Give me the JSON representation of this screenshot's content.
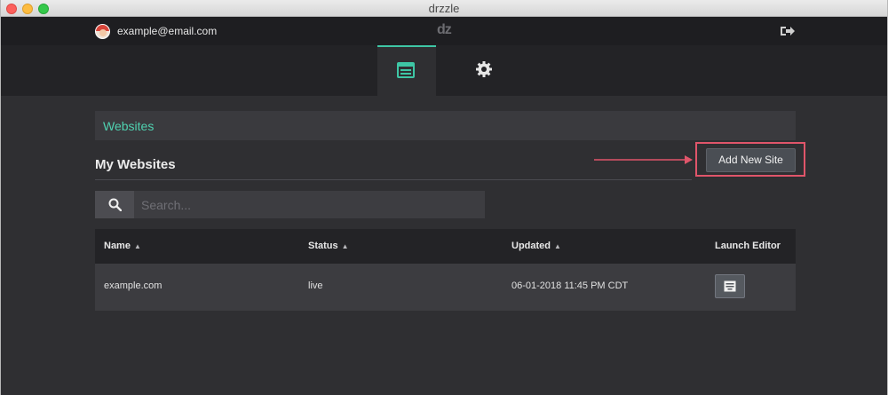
{
  "window": {
    "title": "drzzle"
  },
  "header": {
    "user_email": "example@email.com",
    "logo": "dz"
  },
  "nav": {
    "tabs": [
      {
        "name": "websites",
        "icon": "browser-window-icon",
        "active": true
      },
      {
        "name": "settings",
        "icon": "gear-icon",
        "active": false
      }
    ]
  },
  "section": {
    "title": "Websites"
  },
  "main": {
    "heading": "My Websites",
    "add_button_label": "Add New Site",
    "search_placeholder": "Search...",
    "table": {
      "columns": [
        "Name",
        "Status",
        "Updated",
        "Launch Editor"
      ],
      "rows": [
        {
          "name": "example.com",
          "status": "live",
          "updated": "06-01-2018 11:45 PM CDT"
        }
      ]
    }
  },
  "colors": {
    "accent": "#3ec6a5",
    "highlight": "#e0556a",
    "background": "#2f2f32"
  }
}
